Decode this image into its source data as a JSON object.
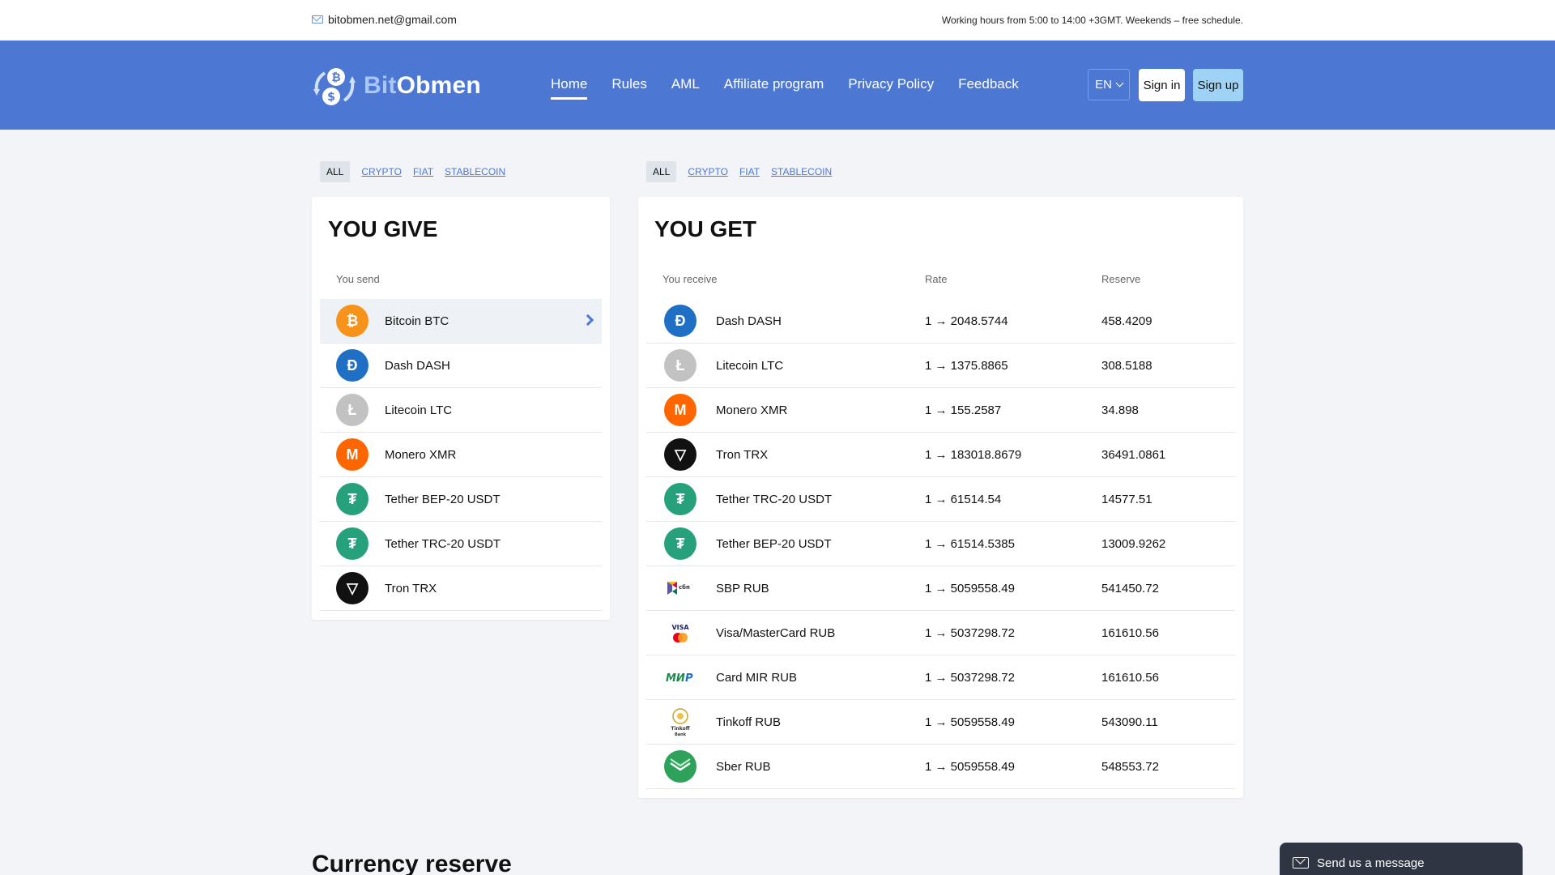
{
  "topbar": {
    "email": "bitobmen.net@gmail.com",
    "hours": "Working hours from 5:00 to 14:00 +3GMT. Weekends – free schedule."
  },
  "brand": {
    "prefix": "Bit",
    "suffix": "Obmen"
  },
  "nav": [
    {
      "label": "Home",
      "active": true
    },
    {
      "label": "Rules"
    },
    {
      "label": "AML"
    },
    {
      "label": "Affiliate program"
    },
    {
      "label": "Privacy Policy"
    },
    {
      "label": "Feedback"
    }
  ],
  "lang": "EN",
  "buttons": {
    "signin": "Sign in",
    "signup": "Sign up"
  },
  "filters": [
    "ALL",
    "CRYPTO",
    "FIAT",
    "STABLECOIN"
  ],
  "give": {
    "title": "YOU GIVE",
    "col_send": "You send",
    "items": [
      {
        "name": "Bitcoin BTC",
        "icon": "bitcoin-icon"
      },
      {
        "name": "Dash DASH",
        "icon": "dash-icon"
      },
      {
        "name": "Litecoin LTC",
        "icon": "litecoin-icon"
      },
      {
        "name": "Monero XMR",
        "icon": "monero-icon"
      },
      {
        "name": "Tether BEP-20 USDT",
        "icon": "tether-icon"
      },
      {
        "name": "Tether TRC-20 USDT",
        "icon": "tether-icon"
      },
      {
        "name": "Tron TRX",
        "icon": "tron-icon"
      }
    ]
  },
  "get": {
    "title": "YOU GET",
    "col_receive": "You receive",
    "col_rate": "Rate",
    "col_reserve": "Reserve",
    "items": [
      {
        "name": "Dash DASH",
        "rate": "1 → 2048.5744",
        "reserve": "458.4209"
      },
      {
        "name": "Litecoin LTC",
        "rate": "1 → 1375.8865",
        "reserve": "308.5188"
      },
      {
        "name": "Monero XMR",
        "rate": "1 → 155.2587",
        "reserve": "34.898"
      },
      {
        "name": "Tron TRX",
        "rate": "1 → 183018.8679",
        "reserve": "36491.0861"
      },
      {
        "name": "Tether TRC-20 USDT",
        "rate": "1 → 61514.54",
        "reserve": "14577.51"
      },
      {
        "name": "Tether BEP-20 USDT",
        "rate": "1 → 61514.5385",
        "reserve": "13009.9262"
      },
      {
        "name": "SBP RUB",
        "rate": "1 → 5059558.49",
        "reserve": "541450.72"
      },
      {
        "name": "Visa/MasterCard RUB",
        "rate": "1 → 5037298.72",
        "reserve": "161610.56"
      },
      {
        "name": "Card MIR RUB",
        "rate": "1 → 5037298.72",
        "reserve": "161610.56"
      },
      {
        "name": "Tinkoff RUB",
        "rate": "1 → 5059558.49",
        "reserve": "543090.11"
      },
      {
        "name": "Sber RUB",
        "rate": "1 → 5059558.49",
        "reserve": "548553.72"
      }
    ]
  },
  "section_title": "Currency reserve",
  "chat": {
    "label": "Send us a message"
  }
}
